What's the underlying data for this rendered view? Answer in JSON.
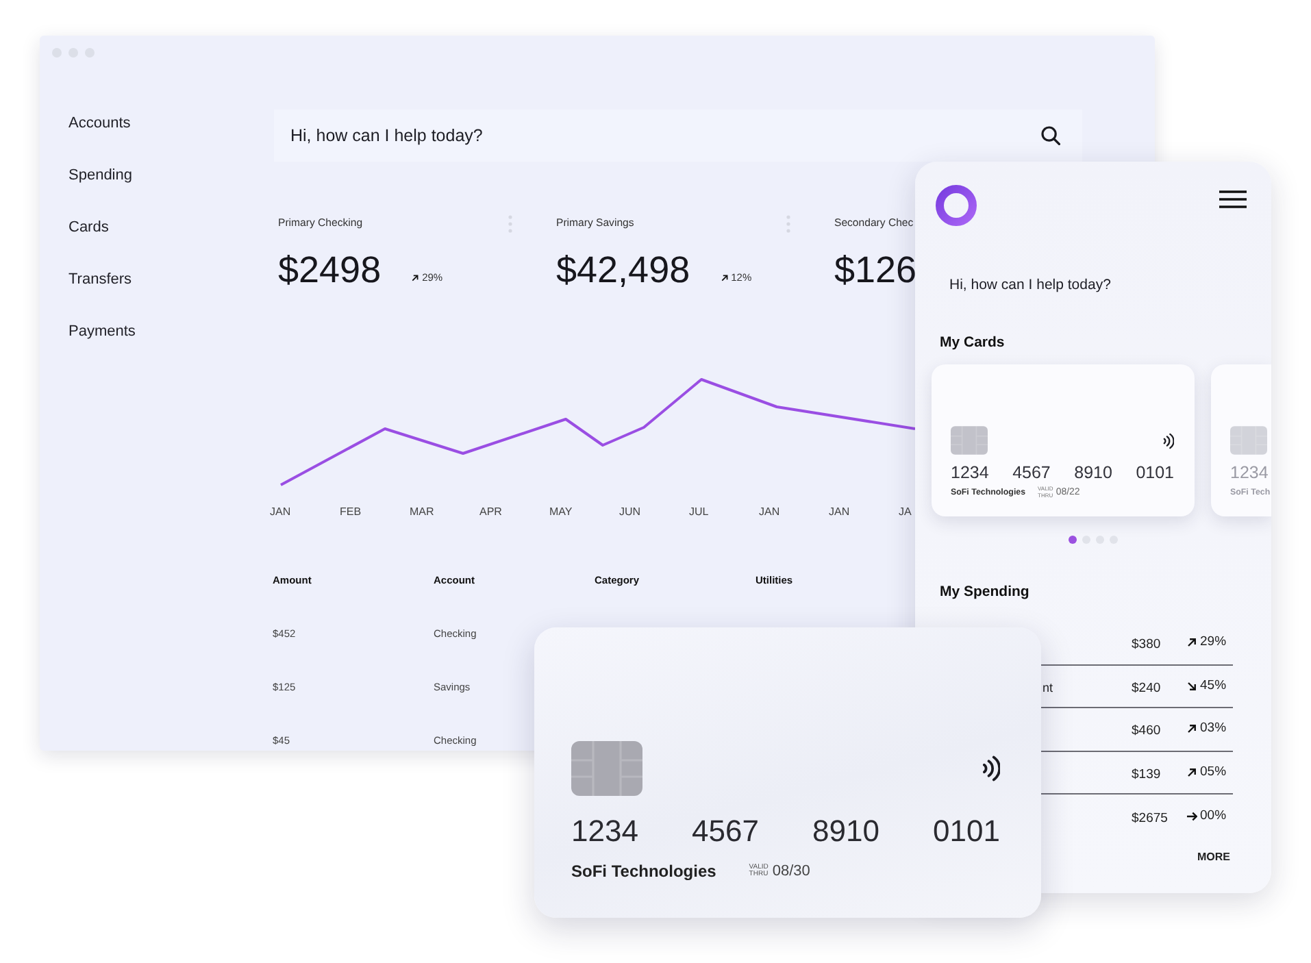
{
  "desktop": {
    "sidebar_items": [
      "Accounts",
      "Spending",
      "Cards",
      "Transfers",
      "Payments"
    ],
    "search": {
      "placeholder": "Hi, how can I help today?"
    },
    "accounts": [
      {
        "name": "Primary Checking",
        "menu": true,
        "balance": "$2498",
        "change": "29%",
        "kind": "rising"
      },
      {
        "name": "Primary Savings",
        "menu": true,
        "balance": "$42,498",
        "change": "12%",
        "kind": "rising"
      },
      {
        "name": "Secondary Chec",
        "menu": false,
        "balance": "$126"
      }
    ],
    "chart": {
      "x_labels": [
        "JAN",
        "FEB",
        "MAR",
        "APR",
        "MAY",
        "JUN",
        "JUL",
        "JAN",
        "JAN",
        "JA"
      ]
    },
    "table": {
      "columns": [
        "Amount",
        "Account",
        "Category",
        "Utilities"
      ],
      "rows": [
        [
          "$452",
          "Checking"
        ],
        [
          "$125",
          "Savings"
        ],
        [
          "$45",
          "Checking"
        ]
      ]
    }
  },
  "phone": {
    "greeting": "Hi, how can I help today?",
    "cards_title": "My Cards",
    "cards": [
      {
        "number_groups": [
          "1234",
          "4567",
          "8910",
          "0101"
        ],
        "holder": "SoFi Technologies",
        "valid_label": "VALID THRU",
        "expiry": "08/22"
      },
      {
        "number_groups": [
          "1234"
        ],
        "holder": "SoFi Tech"
      }
    ],
    "carousel": [
      {
        "selected": true
      },
      {
        "selected": false
      },
      {
        "selected": false
      },
      {
        "selected": false
      }
    ],
    "spending_title": "My Spending",
    "spending": [
      {
        "amount": "$380",
        "change": "29%",
        "kind": "rising"
      },
      {
        "label": "nt",
        "amount": "$240",
        "change": "45%",
        "kind": "falling"
      },
      {
        "amount": "$460",
        "change": "03%",
        "kind": "rising"
      },
      {
        "amount": "$139",
        "change": "05%",
        "kind": "rising"
      },
      {
        "amount": "$2675",
        "change": "00%",
        "kind": "flat"
      }
    ],
    "more": "MORE"
  },
  "card": {
    "number_groups": [
      "1234",
      "4567",
      "8910",
      "0101"
    ],
    "holder": "SoFi Technologies",
    "valid_label": "VALID THRU",
    "expiry": "08/30"
  }
}
